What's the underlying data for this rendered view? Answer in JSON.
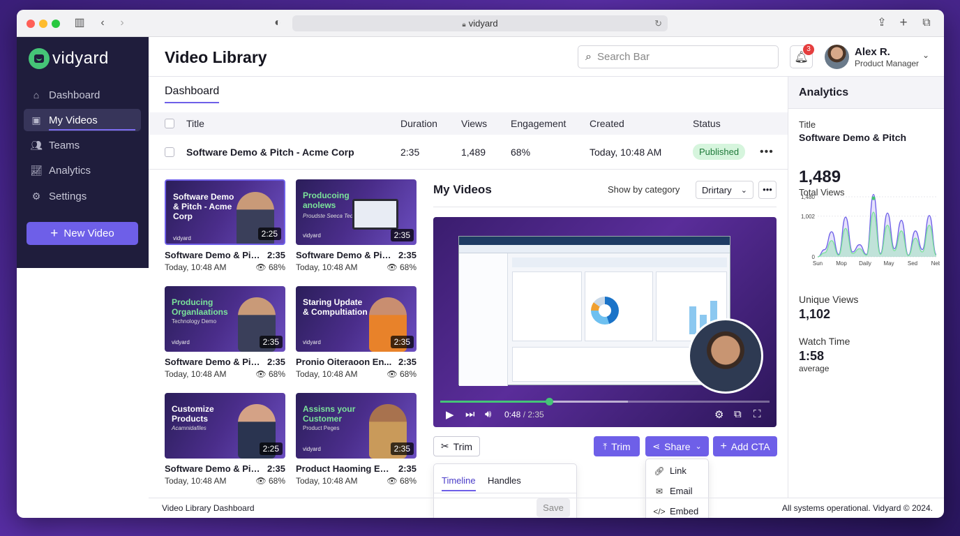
{
  "browser": {
    "url": "vidyard"
  },
  "brand": {
    "name": "vidyard",
    "color": "#45c477"
  },
  "sidebar": {
    "items": [
      {
        "label": "Dashboard",
        "icon": "home-icon"
      },
      {
        "label": "My Videos",
        "icon": "video-icon",
        "active": true
      },
      {
        "label": "Teams",
        "icon": "users-icon"
      },
      {
        "label": "Analytics",
        "icon": "chart-icon"
      },
      {
        "label": "Settings",
        "icon": "gear-icon"
      }
    ],
    "new_video": "New Video"
  },
  "header": {
    "title": "Video Library",
    "search_placeholder": "Search Bar",
    "notifications": "3",
    "user_name": "Alex R.",
    "user_role": "Product Manager"
  },
  "tabs": {
    "active": "Dashboard"
  },
  "table": {
    "columns": [
      "Title",
      "Duration",
      "Views",
      "Engagement",
      "Created",
      "Status"
    ],
    "row": {
      "title": "Software Demo & Pitch - Acme Corp",
      "duration": "2:35",
      "views": "1,489",
      "engagement": "68%",
      "created": "Today, 10:48 AM",
      "status": "Published"
    }
  },
  "videos": [
    {
      "thumb_title": "Software Demo & Pitch - Acme Corp",
      "thumb_sub": "",
      "thumb_dur": "2:25",
      "title": "Software Demo & Pit...",
      "duration": "2:35",
      "date": "Today, 10:48 AM",
      "engagement": "68%"
    },
    {
      "thumb_title": "Producoing anolews",
      "thumb_sub": "Proudste Seeca Technology",
      "thumb_dur": "2:35",
      "title": "Software Demo & Pit...",
      "duration": "2:35",
      "date": "Today, 10:48 AM",
      "engagement": "68%"
    },
    {
      "thumb_title": "Producing Organlaations",
      "thumb_sub": "Technology Demo",
      "thumb_dur": "2:35",
      "title": "Software Demo & Pitc...",
      "duration": "2:35",
      "date": "Today, 10:48 AM",
      "engagement": "68%"
    },
    {
      "thumb_title": "Staring Update & Compultiation",
      "thumb_sub": "",
      "thumb_dur": "2:35",
      "title": "Pronio Oiteraoon En...",
      "duration": "2:35",
      "date": "Today, 10:48 AM",
      "engagement": "68%"
    },
    {
      "thumb_title": "Customize Products",
      "thumb_sub": "Acamnidafiles",
      "thumb_dur": "2:25",
      "title": "Software Demo & Pitc...",
      "duration": "2:35",
      "date": "Today, 10:48 AM",
      "engagement": "68%"
    },
    {
      "thumb_title": "Assisns your Customer",
      "thumb_sub": "Product Peges",
      "thumb_dur": "2:35",
      "title": "Product Haoming En...",
      "duration": "2:35",
      "date": "Today, 10:48 AM",
      "engagement": "68%"
    }
  ],
  "thumb_brand": "vidyard",
  "my_videos": {
    "title": "My Videos",
    "show_label": "Show by category",
    "select_value": "Drirtary"
  },
  "player": {
    "current": "0:48",
    "total": "/ 2:35",
    "progress": 0.33,
    "buffered": 0.57
  },
  "actions": {
    "trim_outline": "Trim",
    "trim": "Trim",
    "share": "Share",
    "add_cta": "Add CTA"
  },
  "trim_panel": {
    "tabs": [
      "Timeline",
      "Handles"
    ],
    "save": "Save"
  },
  "share_menu": [
    "Link",
    "Email",
    "Embed"
  ],
  "analytics": {
    "title": "Analytics",
    "label_title": "Title",
    "video_title": "Software Demo & Pitch",
    "total_views": "1,489",
    "total_views_label": "Total Views",
    "unique_label": "Unique Views",
    "unique_value": "1,102",
    "watch_label": "Watch Time",
    "watch_value": "1:58",
    "watch_sub": "average"
  },
  "chart_data": {
    "type": "line",
    "x": [
      "Sun",
      "Mop",
      "Daily",
      "May",
      "Sed",
      "Neb"
    ],
    "yticks": [
      "1,480",
      "1,002",
      "0"
    ],
    "ylim": [
      0,
      1480
    ],
    "series": [
      {
        "values": [
          0,
          180,
          620,
          60,
          980,
          120,
          300,
          60,
          1540,
          80,
          1080,
          200,
          900,
          40,
          640,
          180,
          1020,
          60
        ],
        "color": "#6e5fe8"
      },
      {
        "values": [
          0,
          100,
          400,
          40,
          700,
          80,
          200,
          40,
          1100,
          60,
          780,
          150,
          640,
          30,
          460,
          120,
          780,
          40
        ],
        "color": "#7be39a"
      }
    ],
    "peak_index": 8,
    "grid": true
  },
  "footer": {
    "left": "Video Library Dashboard",
    "right": "All systems operational. Vidyard © 2024."
  }
}
